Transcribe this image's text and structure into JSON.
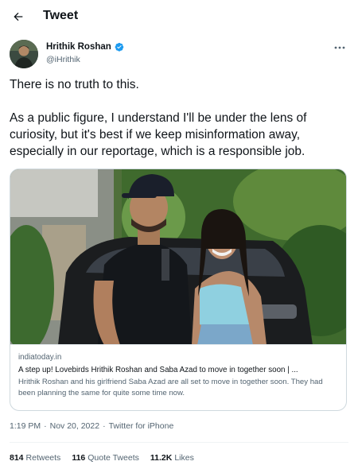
{
  "header": {
    "title": "Tweet"
  },
  "author": {
    "name": "Hrithik Roshan",
    "handle": "@iHrithik",
    "verified_color": "#1d9bf0"
  },
  "tweet": {
    "text": "There is no truth to this.\n\nAs a public figure, I understand I'll be under the lens of curiosity, but it's best if we keep misinformation away, especially in our reportage, which is a responsible job."
  },
  "card": {
    "domain": "indiatoday.in",
    "title": "A step up! Lovebirds Hrithik Roshan and Saba Azad to move in together soon | ...",
    "description": "Hrithik Roshan and his girlfriend Saba Azad are all set to move in together soon. They had been planning the same for quite some time now."
  },
  "meta": {
    "time": "1:19 PM",
    "separator": "·",
    "date": "Nov 20, 2022",
    "source": "Twitter for iPhone"
  },
  "stats": {
    "retweets_count": "814",
    "retweets_label": "Retweets",
    "quotes_count": "116",
    "quotes_label": "Quote Tweets",
    "likes_count": "11.2K",
    "likes_label": "Likes"
  }
}
